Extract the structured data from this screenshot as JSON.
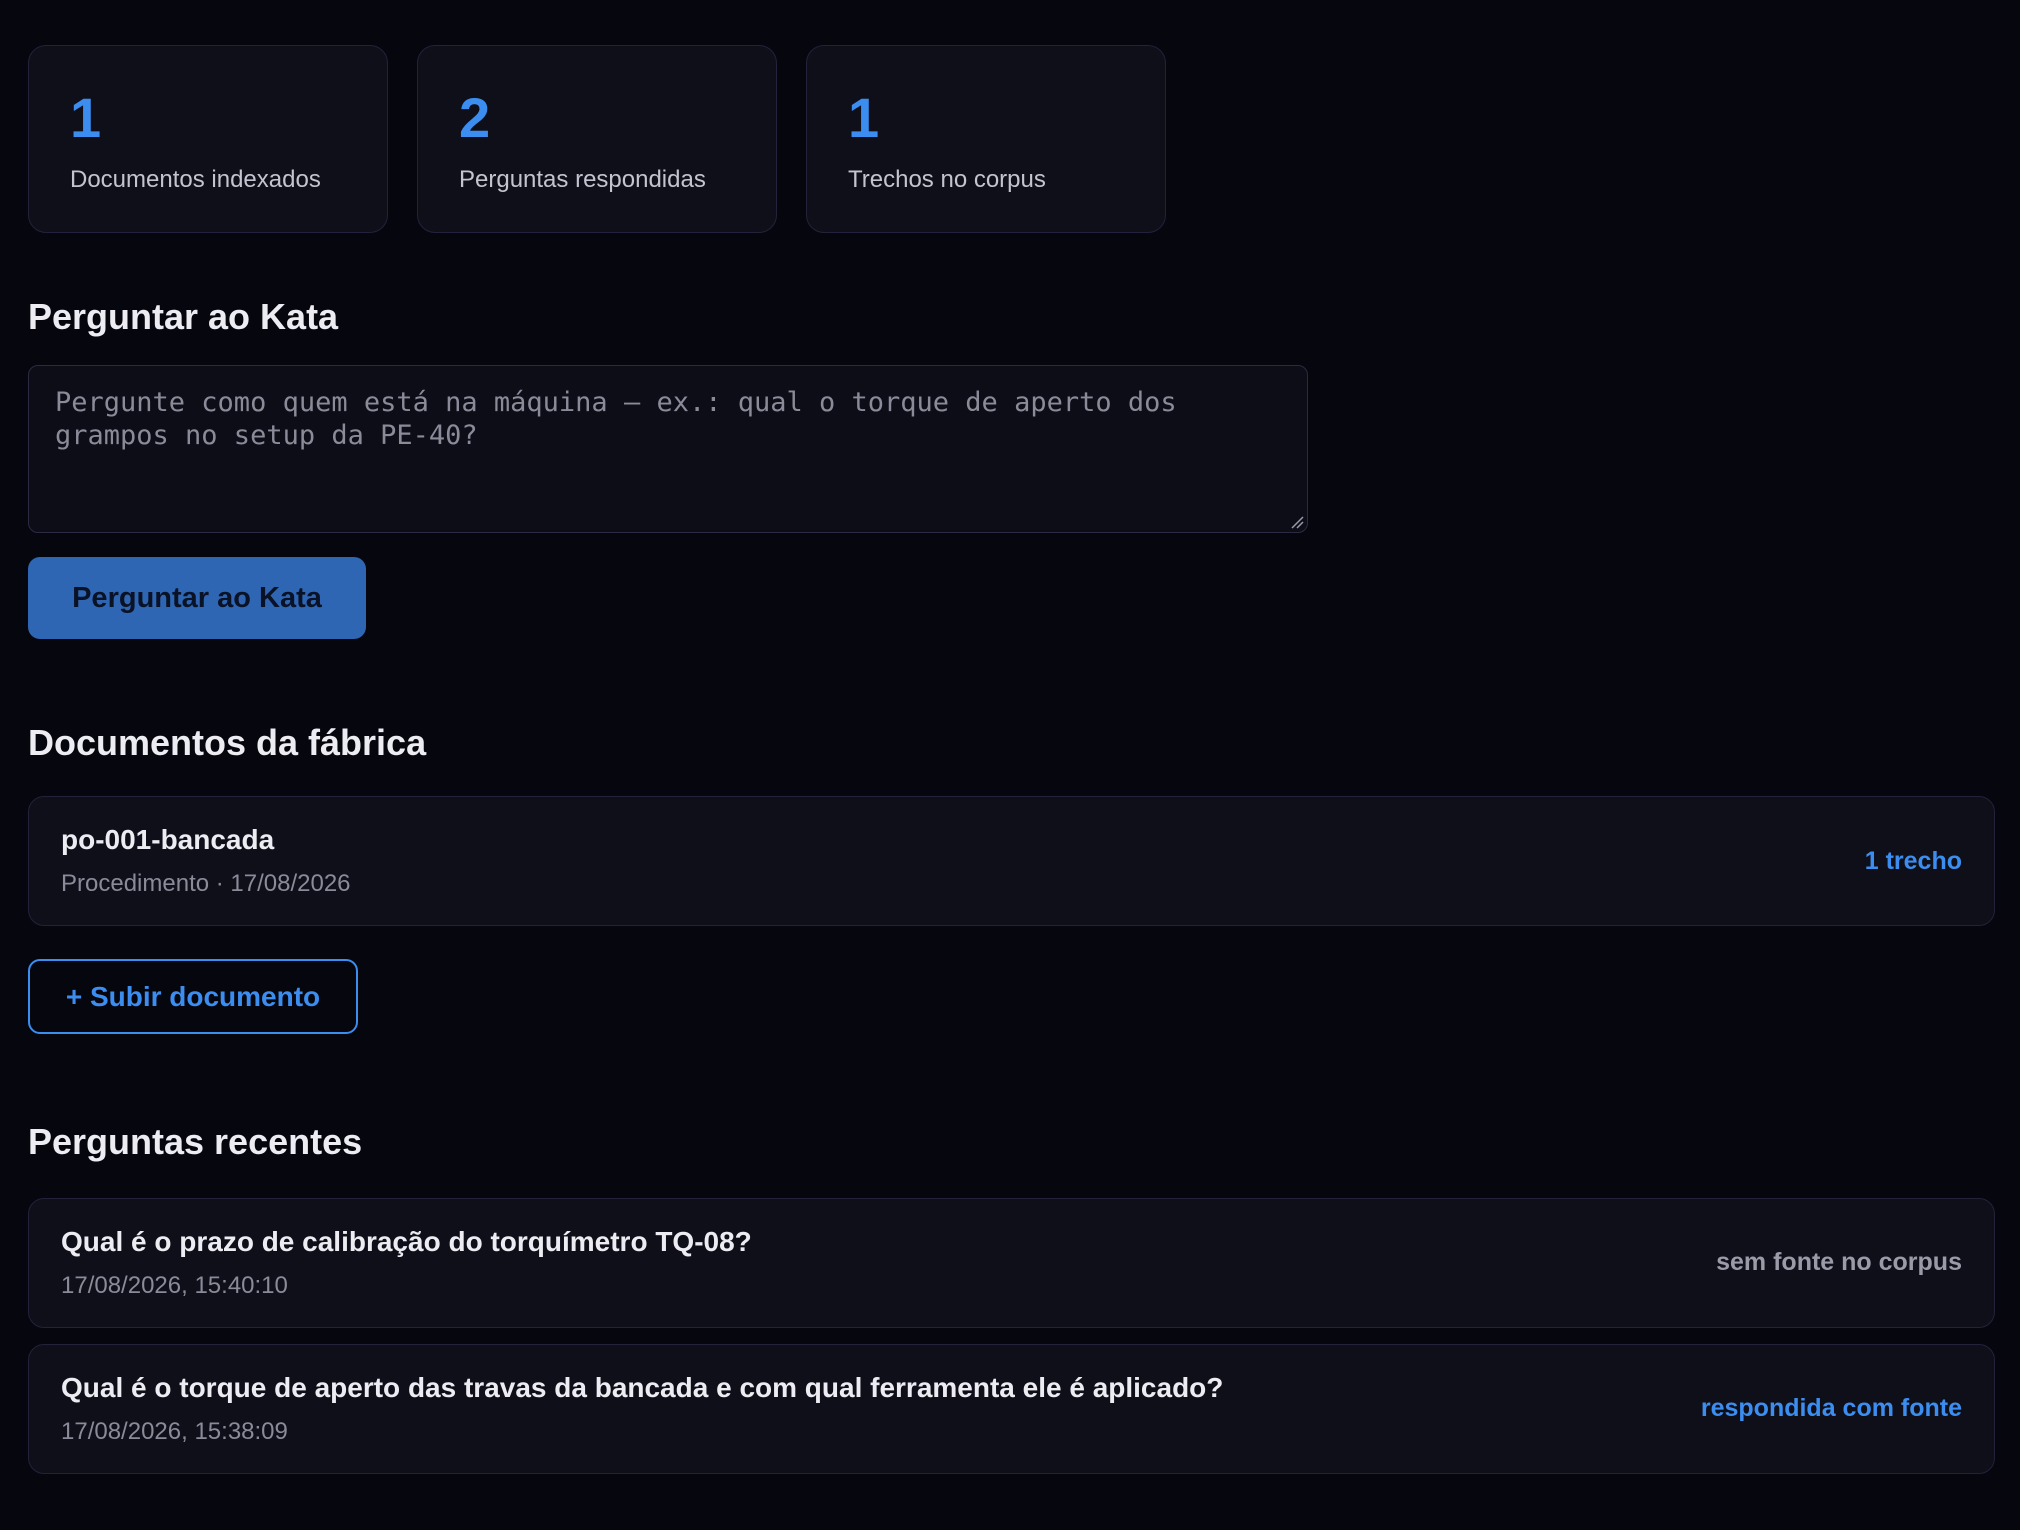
{
  "stats": [
    {
      "value": "1",
      "label": "Documentos indexados"
    },
    {
      "value": "2",
      "label": "Perguntas respondidas"
    },
    {
      "value": "1",
      "label": "Trechos no corpus"
    }
  ],
  "ask": {
    "title": "Perguntar ao Kata",
    "placeholder": "Pergunte como quem está na máquina — ex.: qual o torque de aperto dos grampos no setup da PE-40?",
    "button_label": "Perguntar ao Kata"
  },
  "documents": {
    "title": "Documentos da fábrica",
    "items": [
      {
        "name": "po-001-bancada",
        "meta": "Procedimento · 17/08/2026",
        "chunks": "1 trecho"
      }
    ],
    "upload_label": "+ Subir documento"
  },
  "recent": {
    "title": "Perguntas recentes",
    "items": [
      {
        "question": "Qual é o prazo de calibração do torquímetro TQ-08?",
        "timestamp": "17/08/2026, 15:40:10",
        "status": "sem fonte no corpus"
      },
      {
        "question": "Qual é o torque de aperto das travas da bancada e com qual ferramenta ele é aplicado?",
        "timestamp": "17/08/2026, 15:38:09",
        "status": "respondida com fonte"
      }
    ]
  },
  "colors": {
    "background": "#06060f",
    "card": "#0f0f1a",
    "accent": "#3b8ef0",
    "button": "#2f66b4",
    "muted": "#8a8a98"
  }
}
